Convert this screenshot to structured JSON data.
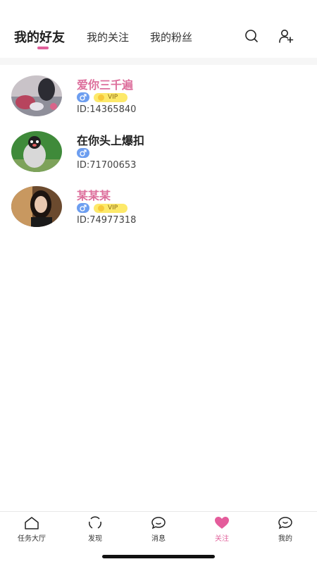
{
  "header": {
    "tabs": [
      {
        "label": "我的好友",
        "active": true
      },
      {
        "label": "我的关注",
        "active": false
      },
      {
        "label": "我的粉丝",
        "active": false
      }
    ],
    "icons": [
      "search-icon",
      "add-user-icon"
    ],
    "accent_color": "#e0609a"
  },
  "friends": [
    {
      "name": "爱你三千遍",
      "id_text": "ID:14365840",
      "gender": "male",
      "vip": true,
      "vip_label": "VIP"
    },
    {
      "name": "在你头上爆扣",
      "id_text": "ID:71700653",
      "gender": "male",
      "vip": false
    },
    {
      "name": "某某某",
      "id_text": "ID:74977318",
      "gender": "male",
      "vip": true,
      "vip_label": "VIP"
    }
  ],
  "bottom_nav": {
    "items": [
      {
        "label": "任务大厅",
        "icon": "home-icon",
        "active": false
      },
      {
        "label": "发现",
        "icon": "discover-icon",
        "active": false
      },
      {
        "label": "消息",
        "icon": "message-icon",
        "active": false
      },
      {
        "label": "关注",
        "icon": "heart-icon",
        "active": true
      },
      {
        "label": "我的",
        "icon": "profile-chat-icon",
        "active": false
      }
    ]
  }
}
